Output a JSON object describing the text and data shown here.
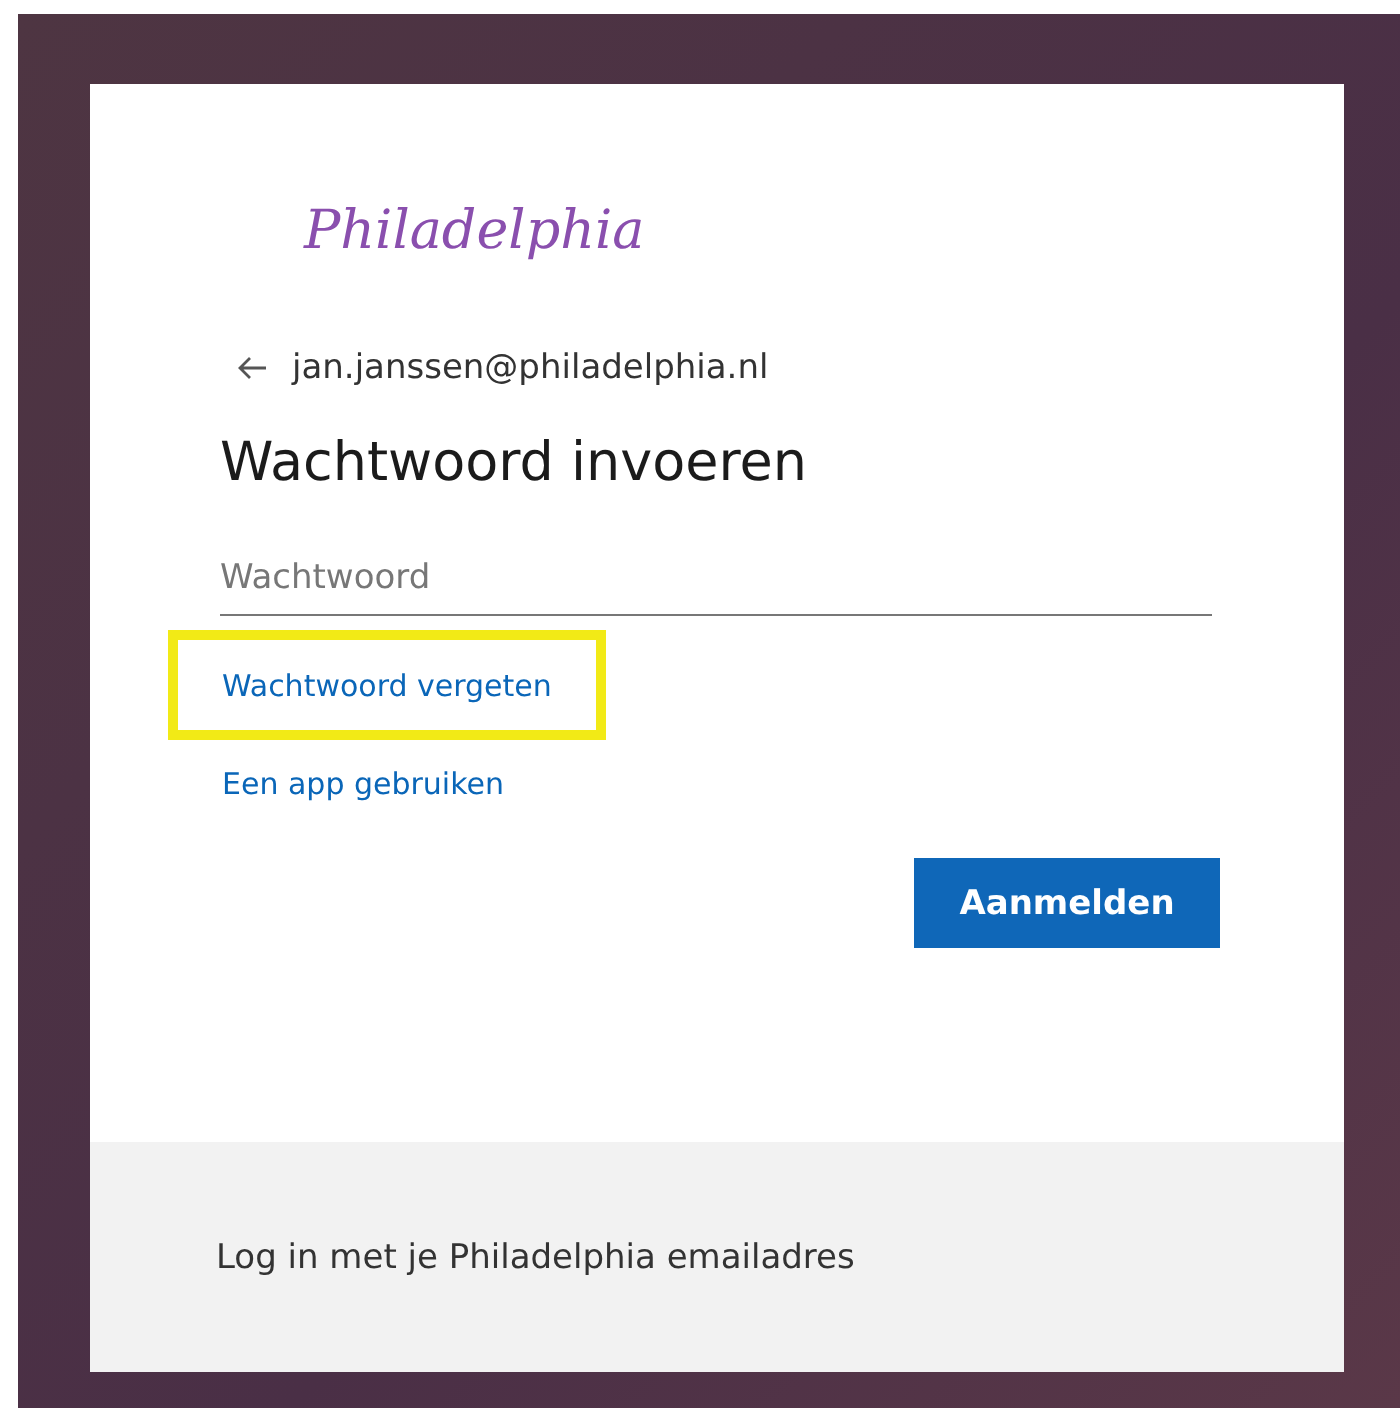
{
  "logo": "Philadelphia",
  "back_email": "jan.janssen@philadelphia.nl",
  "title": "Wachtwoord invoeren",
  "password_field": {
    "placeholder": "Wachtwoord"
  },
  "links": [
    {
      "label": "Wachtwoord vergeten",
      "highlighted": true
    },
    {
      "label": "Een app gebruiken",
      "highlighted": false
    }
  ],
  "button": "Aanmelden",
  "footer": "Log in met je Philadelphia emailadres"
}
